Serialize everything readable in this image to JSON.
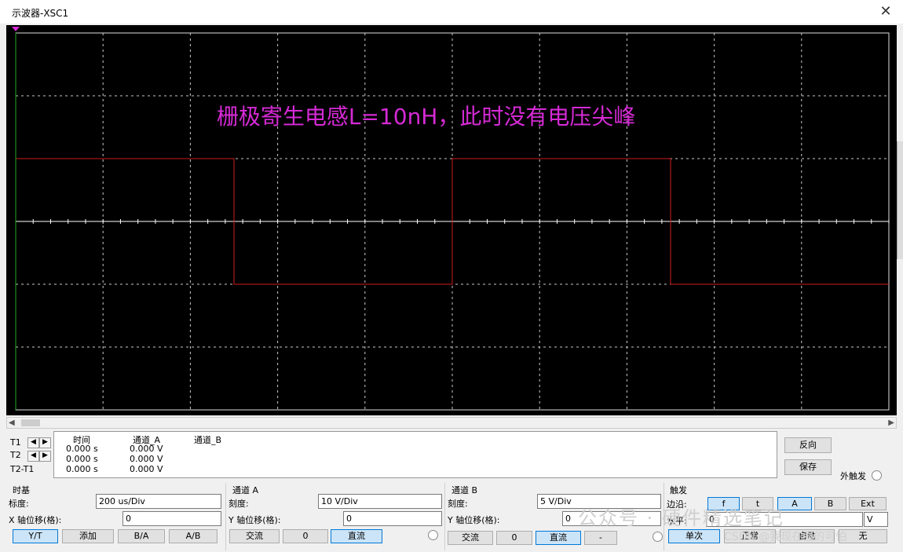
{
  "window": {
    "title": "示波器-XSC1",
    "close": "✕"
  },
  "screen": {
    "annotation": "栅极寄生电感L=10nH，此时没有电压尖峰",
    "colors": {
      "background": "#000000",
      "grid": "#c8c8c8",
      "trace": "#d11b1b",
      "annotation": "#d52ad5"
    }
  },
  "measurements": {
    "rows": [
      "T1",
      "T2",
      "T2-T1"
    ],
    "headers": [
      "时间",
      "通道_A",
      "通道_B"
    ],
    "values": [
      {
        "time": "0.000 s",
        "a": "0.000 V"
      },
      {
        "time": "0.000 s",
        "a": "0.000 V"
      },
      {
        "time": "0.000 s",
        "a": "0.000 V"
      }
    ],
    "reverse_btn": "反向",
    "save_btn": "保存",
    "ext_trigger": "外触发"
  },
  "timebase": {
    "label": "时基",
    "scale_label": "标度:",
    "scale_value": "200 us/Div",
    "xpos_label": "X 轴位移(格):",
    "xpos_value": "0",
    "buttons": [
      "Y/T",
      "添加",
      "B/A",
      "A/B"
    ]
  },
  "channel_a": {
    "label": "通道 A",
    "scale_label": "刻度:",
    "scale_value": "10  V/Div",
    "ypos_label": "Y 轴位移(格):",
    "ypos_value": "0",
    "buttons": [
      "交流",
      "0",
      "直流"
    ]
  },
  "channel_b": {
    "label": "通道 B",
    "scale_label": "刻度:",
    "scale_value": "5  V/Div",
    "ypos_label": "Y 轴位移(格):",
    "ypos_value": "0",
    "buttons": [
      "交流",
      "0",
      "直流",
      "-"
    ]
  },
  "trigger": {
    "label": "触发",
    "edge_label": "边沿:",
    "level_label": "水平:",
    "level_value": "0",
    "edge_buttons": [
      "f",
      "t",
      "A",
      "B",
      "Ext"
    ],
    "mode_buttons": [
      "单次",
      "正常",
      "自动",
      "无"
    ],
    "level_unit": "V"
  },
  "watermark": {
    "main": "公众号 · 硬件精选笔记",
    "sub": "CSDN @我现在强的可怕"
  }
}
